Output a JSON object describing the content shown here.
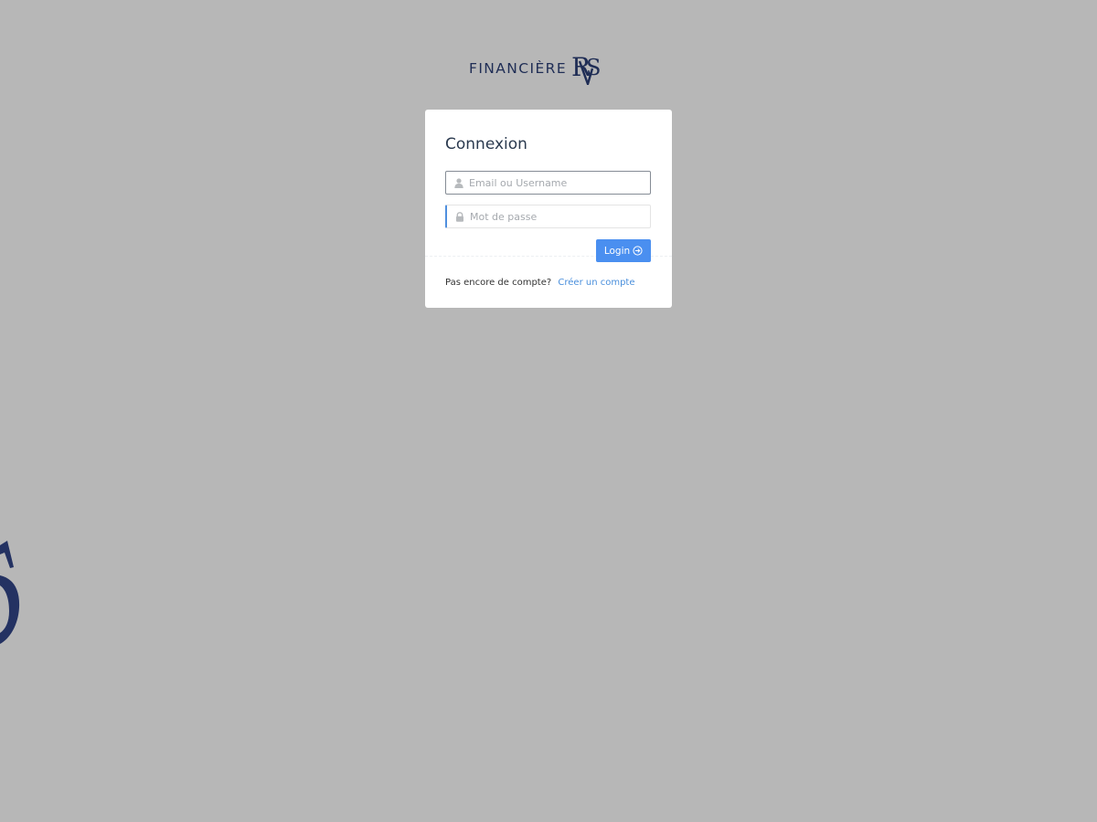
{
  "brand": {
    "name": "FINANCIÈRE",
    "mark": "RVS",
    "color": "#1f2d55"
  },
  "login": {
    "title": "Connexion",
    "username_placeholder": "Email ou Username",
    "username_value": "",
    "password_placeholder": "Mot de passe",
    "password_value": "",
    "submit_label": "Login",
    "submit_icon": "arrow-circle-right-icon",
    "username_icon": "user-icon",
    "password_icon": "lock-icon"
  },
  "signup": {
    "prompt": "Pas encore de compte?",
    "link_label": "Créer un compte"
  },
  "colors": {
    "background": "#b7b7b7",
    "accent": "#4a8ff0",
    "link": "#4a8fdc"
  }
}
